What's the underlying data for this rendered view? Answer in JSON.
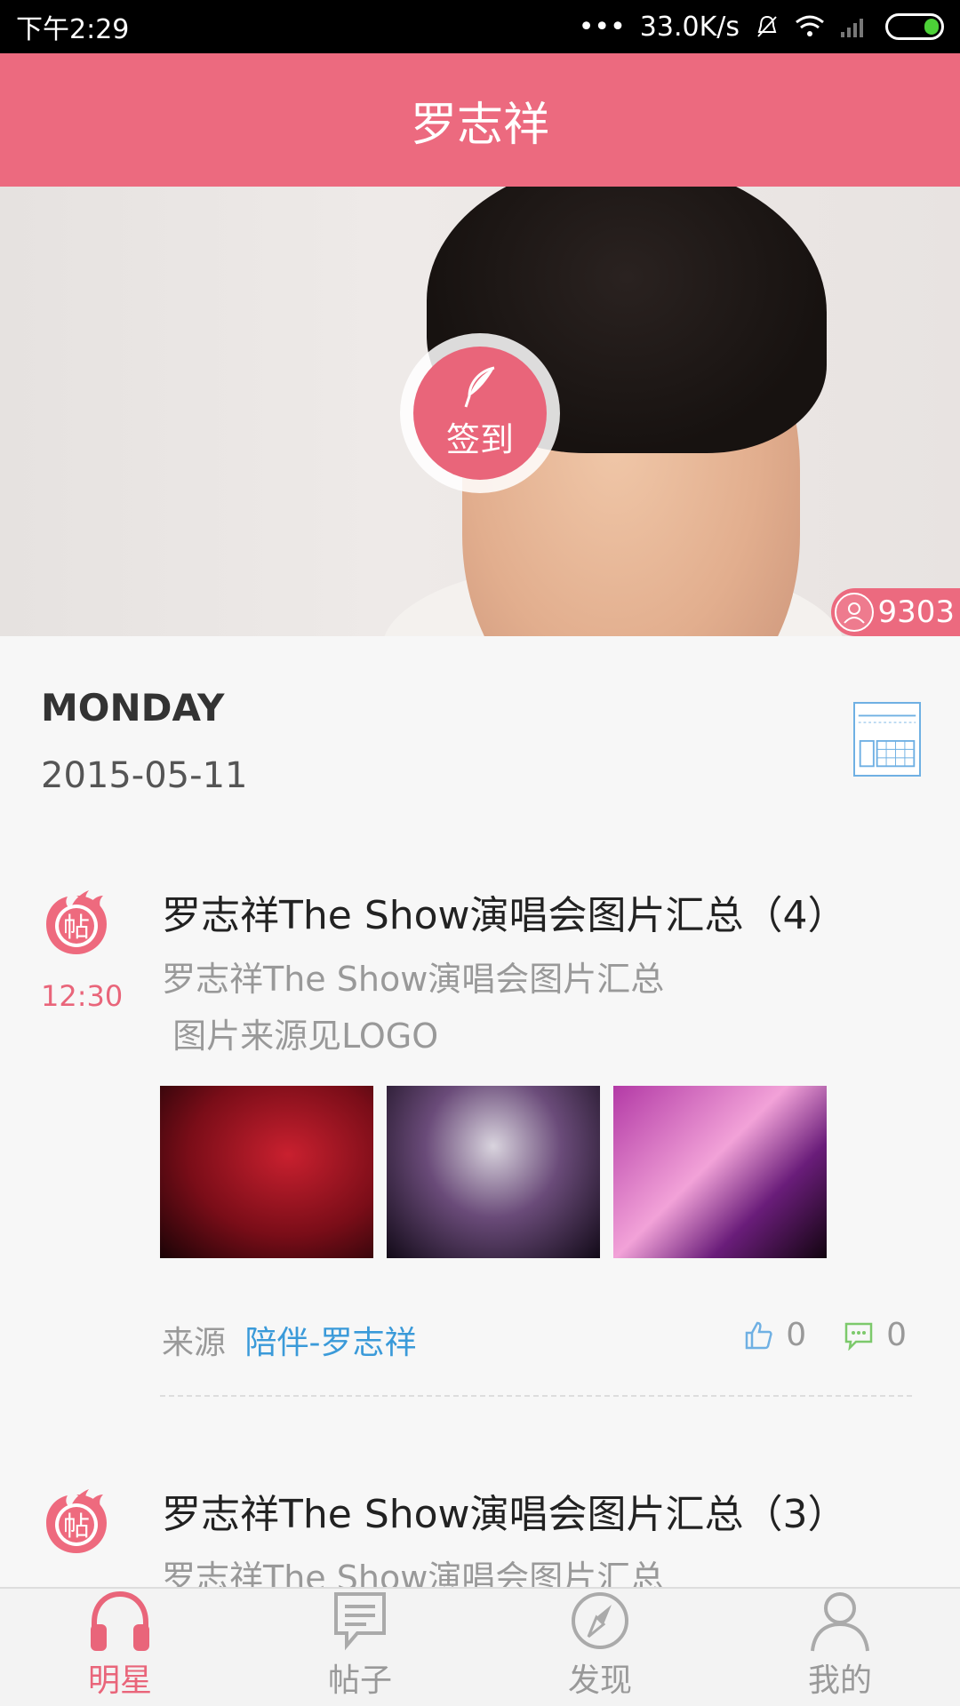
{
  "status_bar": {
    "time": "下午2:29",
    "network_speed": "33.0K/s"
  },
  "header": {
    "title": "罗志祥"
  },
  "banner": {
    "checkin_label": "签到",
    "fans_count": "9303",
    "accent": "#ec6a7f"
  },
  "date_section": {
    "weekday": "MONDAY",
    "date": "2015-05-11"
  },
  "posts": [
    {
      "icon_text": "帖",
      "time": "12:30",
      "title": "罗志祥The Show演唱会图片汇总（4）",
      "body_line1": "罗志祥The Show演唱会图片汇总",
      "body_line2": " 图片来源见LOGO",
      "source_prefix": "来源",
      "source_name": "陪伴-罗志祥",
      "likes": "0",
      "comments": "0"
    },
    {
      "icon_text": "帖",
      "title": "罗志祥The Show演唱会图片汇总（3）",
      "body_line1": "罗志祥The Show演唱会图片汇总"
    }
  ],
  "bottom_nav": [
    {
      "label": "明星",
      "icon": "headphones-icon",
      "active": true
    },
    {
      "label": "帖子",
      "icon": "message-icon",
      "active": false
    },
    {
      "label": "发现",
      "icon": "compass-icon",
      "active": false
    },
    {
      "label": "我的",
      "icon": "profile-icon",
      "active": false
    }
  ]
}
